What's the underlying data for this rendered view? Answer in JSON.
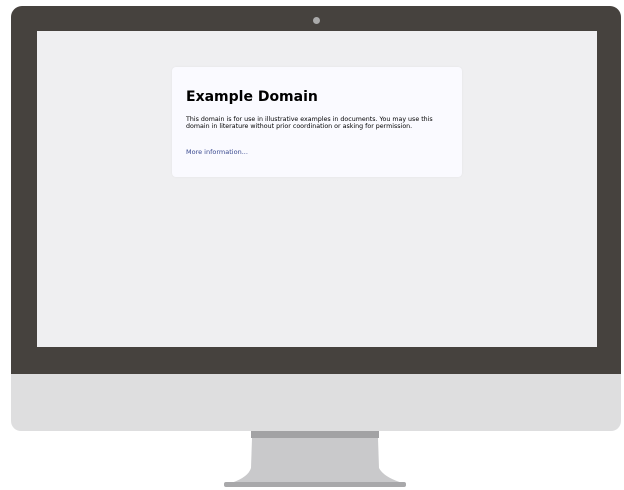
{
  "page": {
    "heading": "Example Domain",
    "body_text": "This domain is for use in illustrative examples in documents. You may use this domain in literature without prior coordination or asking for permission.",
    "link_text": "More information..."
  },
  "colors": {
    "bezel": "#46423e",
    "screen_background": "#efeff1",
    "card_background": "#fafaff",
    "link": "#38488f",
    "chin": "#dededf",
    "stand": "#c9c9cb"
  },
  "icons": {
    "camera": "camera-icon"
  }
}
